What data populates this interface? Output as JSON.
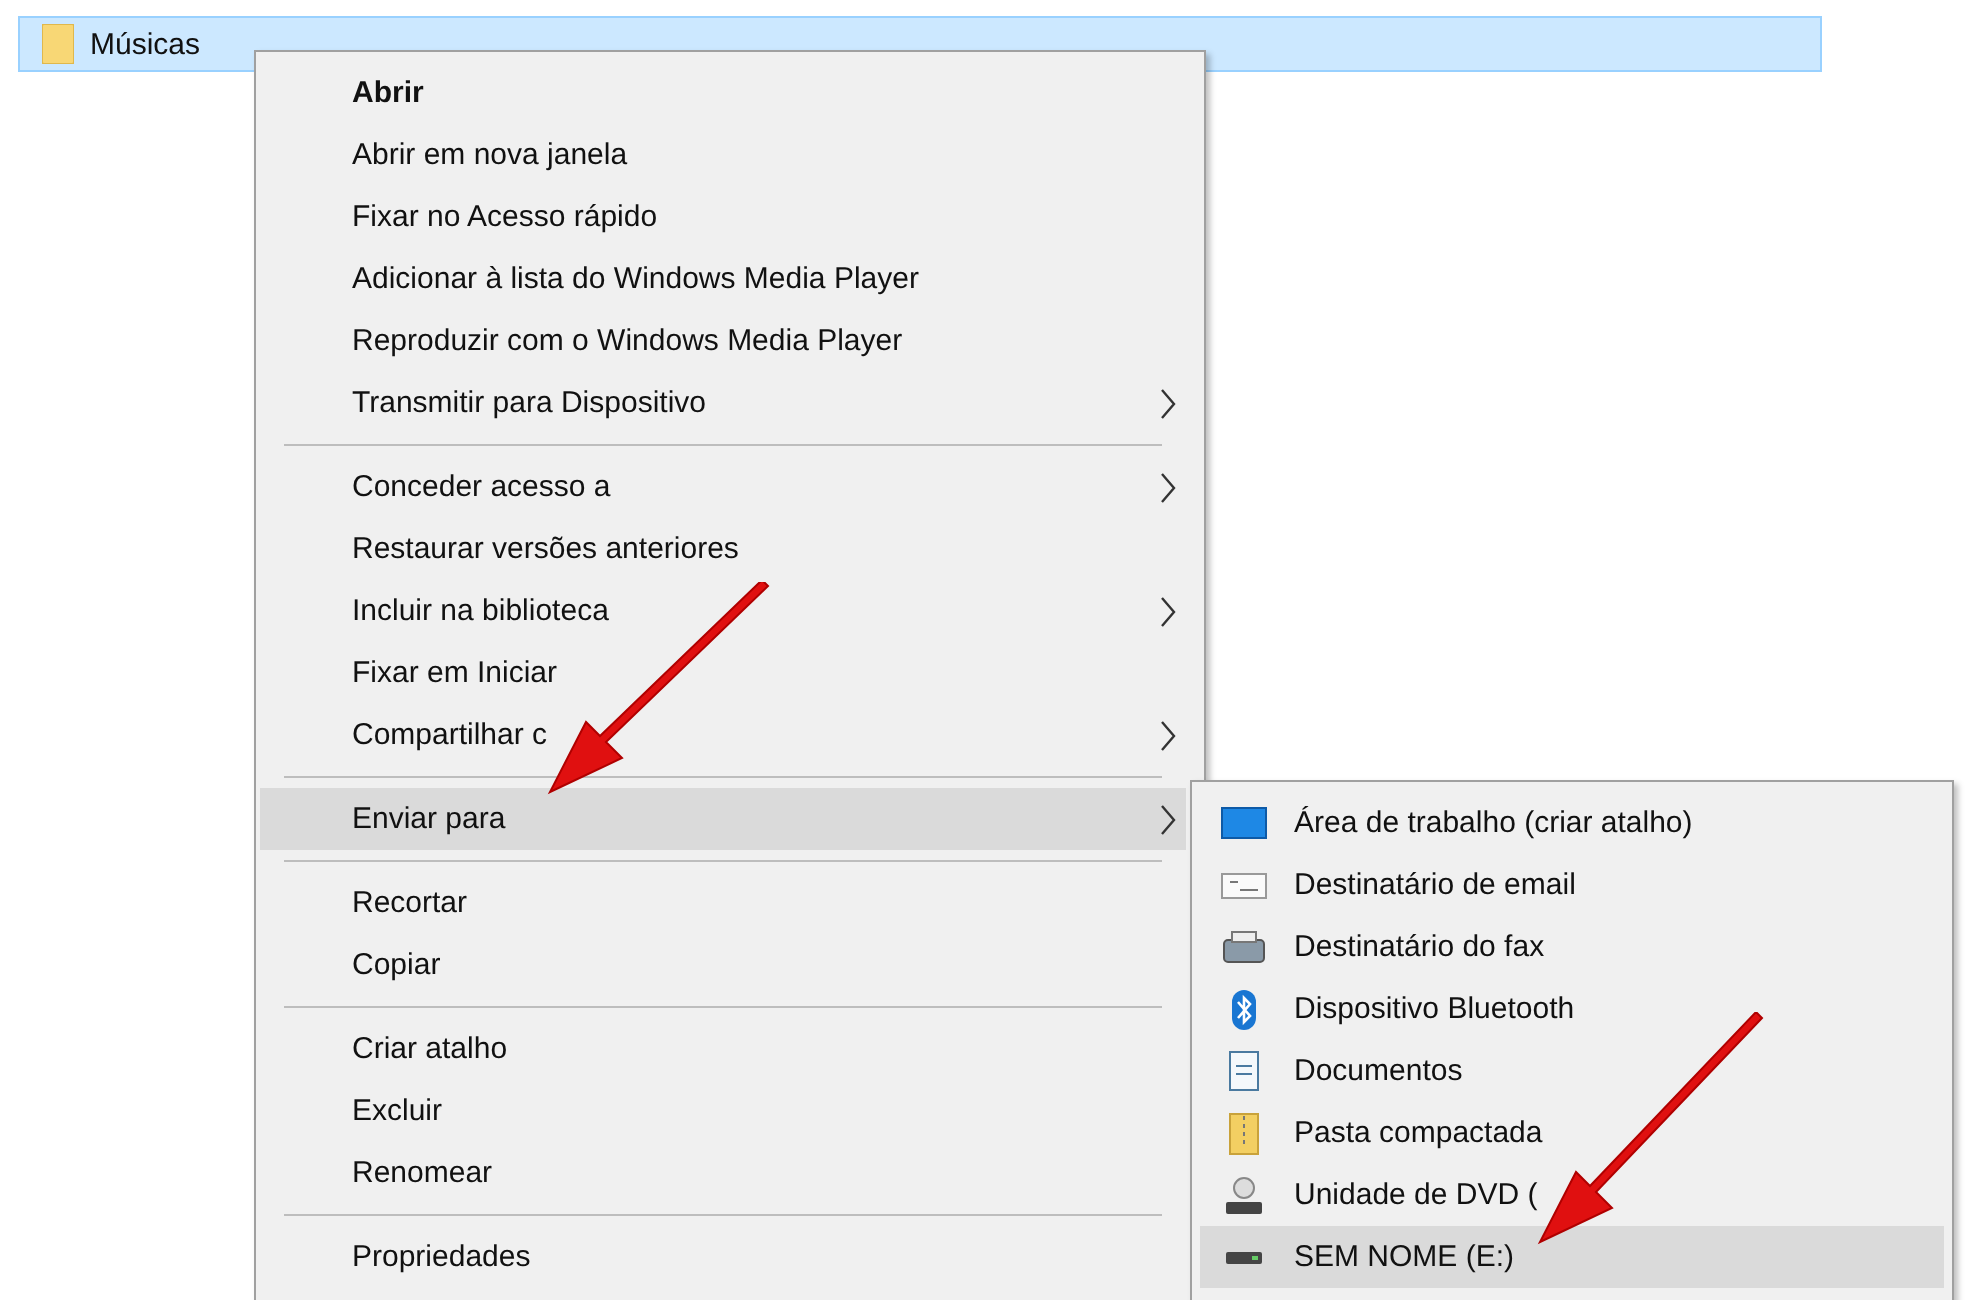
{
  "folder_row": {
    "label": "Músicas",
    "selected": true
  },
  "context_menu": {
    "sections": [
      [
        {
          "label": "Abrir",
          "bold": true,
          "has_submenu": false,
          "selected": false
        },
        {
          "label": "Abrir em nova janela",
          "bold": false,
          "has_submenu": false,
          "selected": false
        },
        {
          "label": "Fixar no Acesso rápido",
          "bold": false,
          "has_submenu": false,
          "selected": false
        },
        {
          "label": "Adicionar à lista do Windows Media Player",
          "bold": false,
          "has_submenu": false,
          "selected": false
        },
        {
          "label": "Reproduzir com o Windows Media Player",
          "bold": false,
          "has_submenu": false,
          "selected": false
        },
        {
          "label": "Transmitir para Dispositivo",
          "bold": false,
          "has_submenu": true,
          "selected": false
        }
      ],
      [
        {
          "label": "Conceder acesso a",
          "bold": false,
          "has_submenu": true,
          "selected": false
        },
        {
          "label": "Restaurar versões anteriores",
          "bold": false,
          "has_submenu": false,
          "selected": false
        },
        {
          "label": "Incluir na biblioteca",
          "bold": false,
          "has_submenu": true,
          "selected": false
        },
        {
          "label": "Fixar em Iniciar",
          "bold": false,
          "has_submenu": false,
          "selected": false
        },
        {
          "label": "Compartilhar c",
          "bold": false,
          "has_submenu": true,
          "selected": false
        }
      ],
      [
        {
          "label": "Enviar para",
          "bold": false,
          "has_submenu": true,
          "selected": true
        }
      ],
      [
        {
          "label": "Recortar",
          "bold": false,
          "has_submenu": false,
          "selected": false
        },
        {
          "label": "Copiar",
          "bold": false,
          "has_submenu": false,
          "selected": false
        }
      ],
      [
        {
          "label": "Criar atalho",
          "bold": false,
          "has_submenu": false,
          "selected": false
        },
        {
          "label": "Excluir",
          "bold": false,
          "has_submenu": false,
          "selected": false
        },
        {
          "label": "Renomear",
          "bold": false,
          "has_submenu": false,
          "selected": false
        }
      ],
      [
        {
          "label": "Propriedades",
          "bold": false,
          "has_submenu": false,
          "selected": false
        }
      ]
    ]
  },
  "send_to_submenu": {
    "items": [
      {
        "label": "Área de trabalho (criar atalho)",
        "selected": false
      },
      {
        "label": "Destinatário de email",
        "selected": false
      },
      {
        "label": "Destinatário do fax",
        "selected": false
      },
      {
        "label": "Dispositivo Bluetooth",
        "selected": false
      },
      {
        "label": "Documentos",
        "selected": false
      },
      {
        "label": "Pasta compactada",
        "selected": false
      },
      {
        "label": "Unidade de DVD (",
        "selected": false
      },
      {
        "label": "SEM NOME (E:)",
        "selected": true
      }
    ]
  }
}
